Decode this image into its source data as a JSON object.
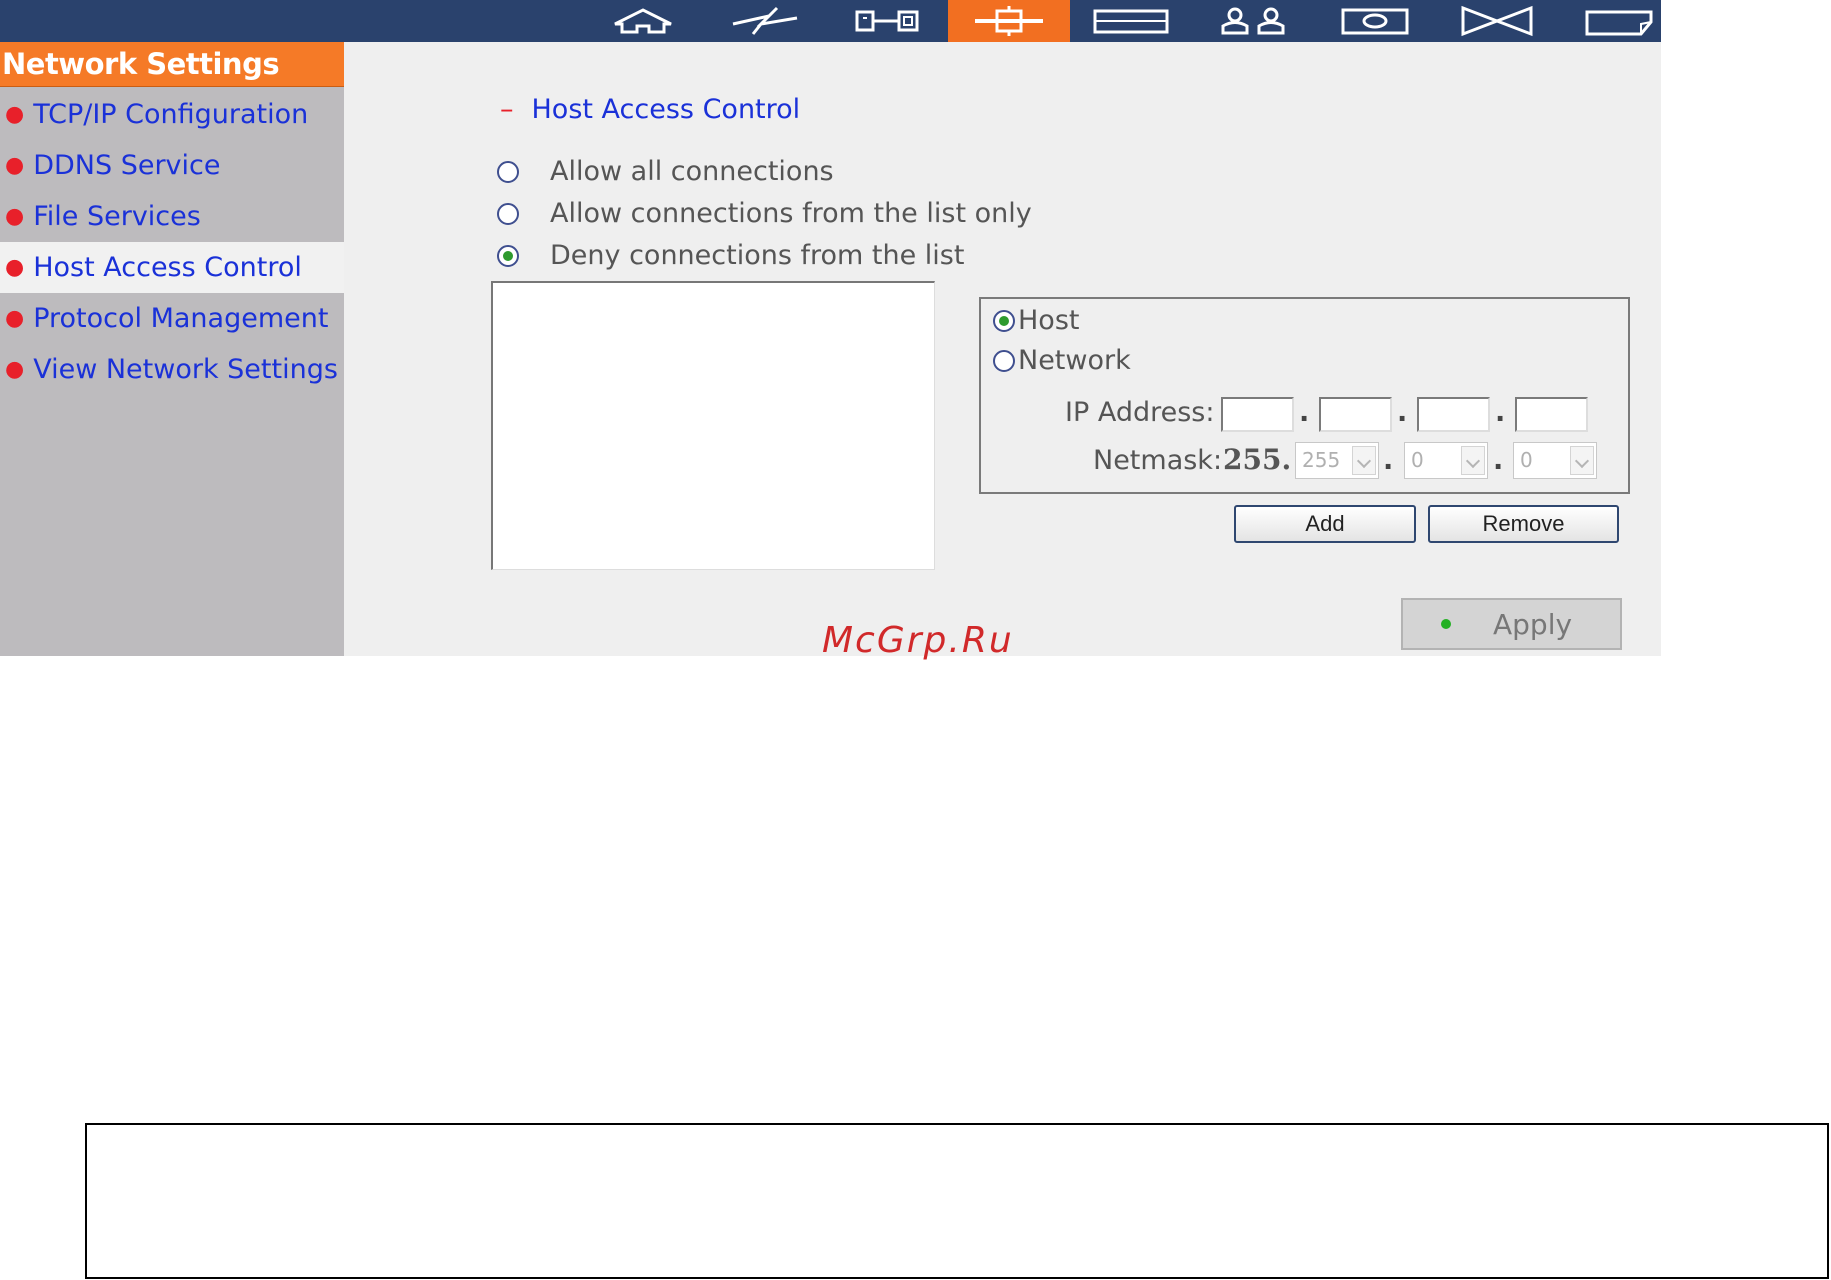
{
  "nav": {
    "icons": [
      {
        "name": "home-icon",
        "active": false
      },
      {
        "name": "quick-config-icon",
        "active": false
      },
      {
        "name": "system-settings-icon",
        "active": false
      },
      {
        "name": "network-settings-icon",
        "active": true
      },
      {
        "name": "device-config-icon",
        "active": false
      },
      {
        "name": "user-management-icon",
        "active": false
      },
      {
        "name": "network-share-icon",
        "active": false
      },
      {
        "name": "system-tools-icon",
        "active": false
      },
      {
        "name": "statistics-log-icon",
        "active": false
      }
    ],
    "active_color": "#f26f21",
    "bar_color": "#2a426d"
  },
  "sidebar": {
    "title": "Network Settings",
    "items": [
      {
        "label": "TCP/IP Configuration",
        "active": false
      },
      {
        "label": "DDNS Service",
        "active": false
      },
      {
        "label": "File Services",
        "active": false
      },
      {
        "label": "Host Access Control",
        "active": true
      },
      {
        "label": "Protocol Management",
        "active": false
      },
      {
        "label": "View Network Settings",
        "active": false
      }
    ]
  },
  "main": {
    "section_title": "Host Access Control",
    "section_dash": "–",
    "modes": [
      {
        "label": "Allow all connections",
        "checked": false
      },
      {
        "label": "Allow connections from the list only",
        "checked": false
      },
      {
        "label": "Deny connections from the list",
        "checked": true
      }
    ],
    "entry": {
      "types": [
        {
          "label": "Host",
          "checked": true
        },
        {
          "label": "Network",
          "checked": false
        }
      ],
      "ip_label": "IP Address:",
      "ip_values": [
        "",
        "",
        "",
        ""
      ],
      "dot": ".",
      "netmask_label": "Netmask:",
      "netmask_prefix": "255.",
      "netmask_selects": [
        "255",
        "0",
        "0"
      ]
    },
    "add_label": "Add",
    "remove_label": "Remove",
    "apply_label": "Apply"
  },
  "watermark": "McGrp.Ru"
}
